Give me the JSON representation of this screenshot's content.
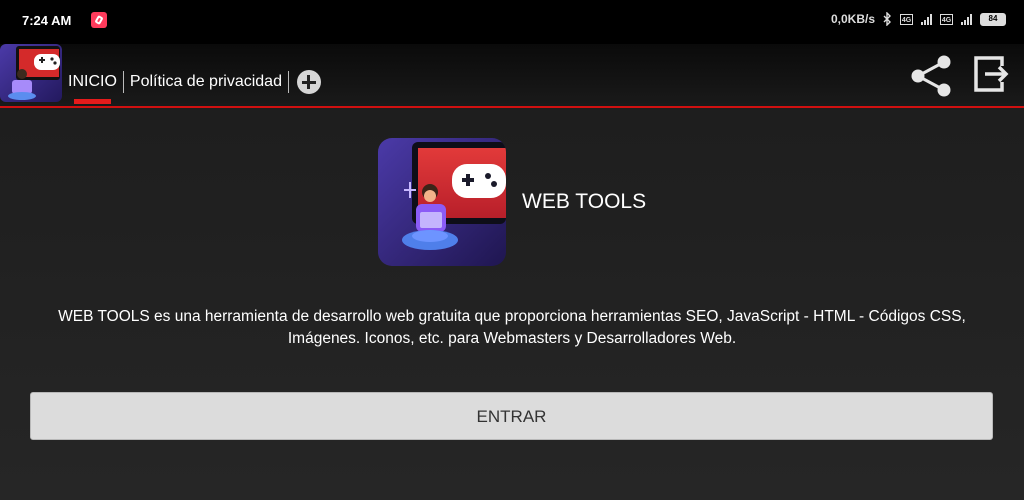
{
  "status_bar": {
    "time": "7:24 AM",
    "net_speed": "0,0KB/s",
    "sim1_label": "4G",
    "sim2_label": "4G",
    "battery": "84",
    "icons": [
      "notification-icon",
      "bluetooth-icon",
      "signal-icon",
      "battery-icon"
    ]
  },
  "app_bar": {
    "tabs": [
      {
        "label": "INICIO",
        "active": true
      },
      {
        "label": "Política de privacidad",
        "active": false
      }
    ],
    "icons": [
      "app-logo-icon",
      "add-tab-icon",
      "share-icon",
      "exit-icon"
    ],
    "accent_color": "#e51b1b"
  },
  "main": {
    "app_name": "WEB TOOLS",
    "description": "WEB TOOLS es una herramienta de desarrollo web gratuita que proporciona herramientas SEO, JavaScript - HTML - Códigos CSS, Imágenes. Iconos, etc. para Webmasters y Desarrolladores Web.",
    "enter_button_label": "ENTRAR"
  },
  "colors": {
    "background": "#1e1e1e",
    "button_bg": "#dcdcdc",
    "logo_purple": "#3a2a8a",
    "logo_red": "#d42a2a"
  }
}
